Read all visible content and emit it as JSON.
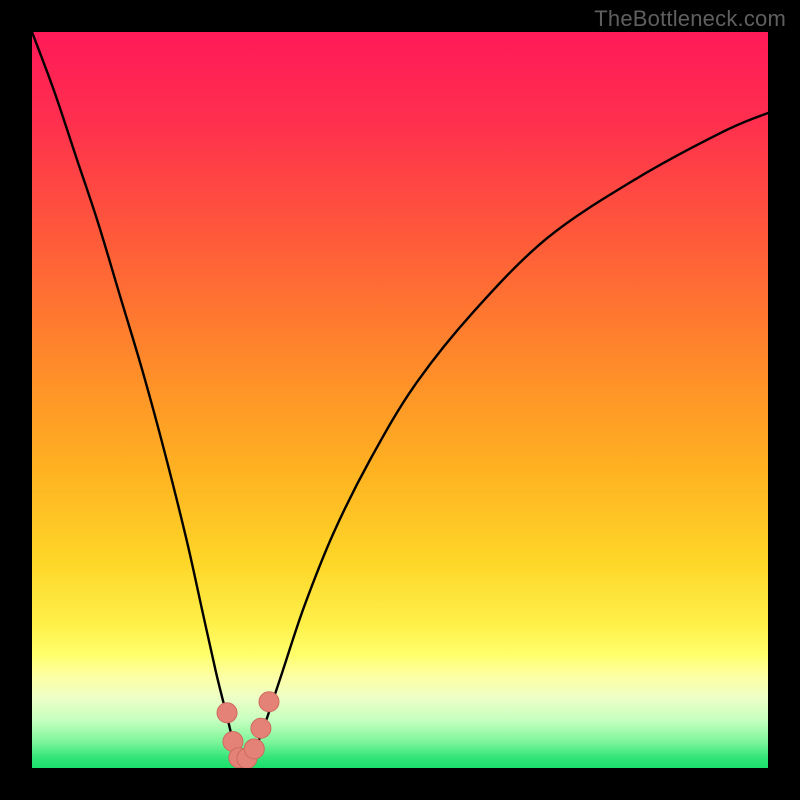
{
  "watermark": "TheBottleneck.com",
  "colors": {
    "bg_black": "#000000",
    "curve": "#000000",
    "marker_fill": "#e48277",
    "marker_stroke": "#cf6a60",
    "gradient_stops": [
      {
        "offset": 0.0,
        "color": "#ff1a58"
      },
      {
        "offset": 0.12,
        "color": "#ff2f4e"
      },
      {
        "offset": 0.28,
        "color": "#ff5a3a"
      },
      {
        "offset": 0.45,
        "color": "#ff8a2a"
      },
      {
        "offset": 0.6,
        "color": "#ffb321"
      },
      {
        "offset": 0.72,
        "color": "#fed628"
      },
      {
        "offset": 0.805,
        "color": "#fff04a"
      },
      {
        "offset": 0.845,
        "color": "#ffff6a"
      },
      {
        "offset": 0.875,
        "color": "#fdffa3"
      },
      {
        "offset": 0.905,
        "color": "#edffc7"
      },
      {
        "offset": 0.935,
        "color": "#c6ffc0"
      },
      {
        "offset": 0.965,
        "color": "#7cf59a"
      },
      {
        "offset": 0.985,
        "color": "#35e57a"
      },
      {
        "offset": 1.0,
        "color": "#1adf6a"
      }
    ]
  },
  "chart_data": {
    "type": "line",
    "title": "",
    "xlabel": "",
    "ylabel": "",
    "xlim": [
      0,
      100
    ],
    "ylim": [
      0,
      100
    ],
    "series": [
      {
        "name": "bottleneck-curve",
        "x": [
          0,
          3,
          6,
          9,
          12,
          15,
          18,
          21,
          23,
          25,
          26.5,
          27.5,
          28.5,
          29.5,
          30.5,
          32,
          34,
          37,
          41,
          46,
          52,
          60,
          70,
          82,
          94,
          100
        ],
        "y": [
          100,
          92,
          83,
          74,
          64,
          54,
          43,
          31,
          22,
          13,
          7,
          3,
          1,
          1,
          3,
          7,
          13,
          22,
          32,
          42,
          52,
          62,
          72,
          80,
          86.5,
          89
        ]
      }
    ],
    "markers": {
      "name": "optimal-points",
      "points": [
        {
          "x": 26.5,
          "y": 7.5
        },
        {
          "x": 27.3,
          "y": 3.6
        },
        {
          "x": 28.1,
          "y": 1.4
        },
        {
          "x": 29.2,
          "y": 1.3
        },
        {
          "x": 30.2,
          "y": 2.6
        },
        {
          "x": 31.1,
          "y": 5.4
        },
        {
          "x": 32.2,
          "y": 9.0
        }
      ]
    }
  }
}
